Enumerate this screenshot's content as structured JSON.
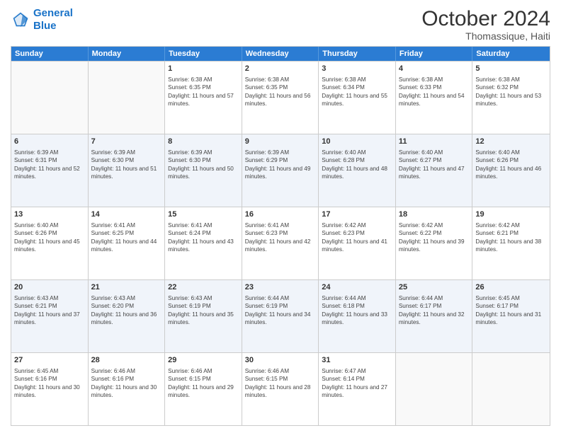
{
  "header": {
    "logo_line1": "General",
    "logo_line2": "Blue",
    "month": "October 2024",
    "location": "Thomassique, Haiti"
  },
  "days": [
    "Sunday",
    "Monday",
    "Tuesday",
    "Wednesday",
    "Thursday",
    "Friday",
    "Saturday"
  ],
  "weeks": [
    [
      {
        "day": "",
        "sunrise": "",
        "sunset": "",
        "daylight": ""
      },
      {
        "day": "",
        "sunrise": "",
        "sunset": "",
        "daylight": ""
      },
      {
        "day": "1",
        "sunrise": "Sunrise: 6:38 AM",
        "sunset": "Sunset: 6:35 PM",
        "daylight": "Daylight: 11 hours and 57 minutes."
      },
      {
        "day": "2",
        "sunrise": "Sunrise: 6:38 AM",
        "sunset": "Sunset: 6:35 PM",
        "daylight": "Daylight: 11 hours and 56 minutes."
      },
      {
        "day": "3",
        "sunrise": "Sunrise: 6:38 AM",
        "sunset": "Sunset: 6:34 PM",
        "daylight": "Daylight: 11 hours and 55 minutes."
      },
      {
        "day": "4",
        "sunrise": "Sunrise: 6:38 AM",
        "sunset": "Sunset: 6:33 PM",
        "daylight": "Daylight: 11 hours and 54 minutes."
      },
      {
        "day": "5",
        "sunrise": "Sunrise: 6:38 AM",
        "sunset": "Sunset: 6:32 PM",
        "daylight": "Daylight: 11 hours and 53 minutes."
      }
    ],
    [
      {
        "day": "6",
        "sunrise": "Sunrise: 6:39 AM",
        "sunset": "Sunset: 6:31 PM",
        "daylight": "Daylight: 11 hours and 52 minutes."
      },
      {
        "day": "7",
        "sunrise": "Sunrise: 6:39 AM",
        "sunset": "Sunset: 6:30 PM",
        "daylight": "Daylight: 11 hours and 51 minutes."
      },
      {
        "day": "8",
        "sunrise": "Sunrise: 6:39 AM",
        "sunset": "Sunset: 6:30 PM",
        "daylight": "Daylight: 11 hours and 50 minutes."
      },
      {
        "day": "9",
        "sunrise": "Sunrise: 6:39 AM",
        "sunset": "Sunset: 6:29 PM",
        "daylight": "Daylight: 11 hours and 49 minutes."
      },
      {
        "day": "10",
        "sunrise": "Sunrise: 6:40 AM",
        "sunset": "Sunset: 6:28 PM",
        "daylight": "Daylight: 11 hours and 48 minutes."
      },
      {
        "day": "11",
        "sunrise": "Sunrise: 6:40 AM",
        "sunset": "Sunset: 6:27 PM",
        "daylight": "Daylight: 11 hours and 47 minutes."
      },
      {
        "day": "12",
        "sunrise": "Sunrise: 6:40 AM",
        "sunset": "Sunset: 6:26 PM",
        "daylight": "Daylight: 11 hours and 46 minutes."
      }
    ],
    [
      {
        "day": "13",
        "sunrise": "Sunrise: 6:40 AM",
        "sunset": "Sunset: 6:26 PM",
        "daylight": "Daylight: 11 hours and 45 minutes."
      },
      {
        "day": "14",
        "sunrise": "Sunrise: 6:41 AM",
        "sunset": "Sunset: 6:25 PM",
        "daylight": "Daylight: 11 hours and 44 minutes."
      },
      {
        "day": "15",
        "sunrise": "Sunrise: 6:41 AM",
        "sunset": "Sunset: 6:24 PM",
        "daylight": "Daylight: 11 hours and 43 minutes."
      },
      {
        "day": "16",
        "sunrise": "Sunrise: 6:41 AM",
        "sunset": "Sunset: 6:23 PM",
        "daylight": "Daylight: 11 hours and 42 minutes."
      },
      {
        "day": "17",
        "sunrise": "Sunrise: 6:42 AM",
        "sunset": "Sunset: 6:23 PM",
        "daylight": "Daylight: 11 hours and 41 minutes."
      },
      {
        "day": "18",
        "sunrise": "Sunrise: 6:42 AM",
        "sunset": "Sunset: 6:22 PM",
        "daylight": "Daylight: 11 hours and 39 minutes."
      },
      {
        "day": "19",
        "sunrise": "Sunrise: 6:42 AM",
        "sunset": "Sunset: 6:21 PM",
        "daylight": "Daylight: 11 hours and 38 minutes."
      }
    ],
    [
      {
        "day": "20",
        "sunrise": "Sunrise: 6:43 AM",
        "sunset": "Sunset: 6:21 PM",
        "daylight": "Daylight: 11 hours and 37 minutes."
      },
      {
        "day": "21",
        "sunrise": "Sunrise: 6:43 AM",
        "sunset": "Sunset: 6:20 PM",
        "daylight": "Daylight: 11 hours and 36 minutes."
      },
      {
        "day": "22",
        "sunrise": "Sunrise: 6:43 AM",
        "sunset": "Sunset: 6:19 PM",
        "daylight": "Daylight: 11 hours and 35 minutes."
      },
      {
        "day": "23",
        "sunrise": "Sunrise: 6:44 AM",
        "sunset": "Sunset: 6:19 PM",
        "daylight": "Daylight: 11 hours and 34 minutes."
      },
      {
        "day": "24",
        "sunrise": "Sunrise: 6:44 AM",
        "sunset": "Sunset: 6:18 PM",
        "daylight": "Daylight: 11 hours and 33 minutes."
      },
      {
        "day": "25",
        "sunrise": "Sunrise: 6:44 AM",
        "sunset": "Sunset: 6:17 PM",
        "daylight": "Daylight: 11 hours and 32 minutes."
      },
      {
        "day": "26",
        "sunrise": "Sunrise: 6:45 AM",
        "sunset": "Sunset: 6:17 PM",
        "daylight": "Daylight: 11 hours and 31 minutes."
      }
    ],
    [
      {
        "day": "27",
        "sunrise": "Sunrise: 6:45 AM",
        "sunset": "Sunset: 6:16 PM",
        "daylight": "Daylight: 11 hours and 30 minutes."
      },
      {
        "day": "28",
        "sunrise": "Sunrise: 6:46 AM",
        "sunset": "Sunset: 6:16 PM",
        "daylight": "Daylight: 11 hours and 30 minutes."
      },
      {
        "day": "29",
        "sunrise": "Sunrise: 6:46 AM",
        "sunset": "Sunset: 6:15 PM",
        "daylight": "Daylight: 11 hours and 29 minutes."
      },
      {
        "day": "30",
        "sunrise": "Sunrise: 6:46 AM",
        "sunset": "Sunset: 6:15 PM",
        "daylight": "Daylight: 11 hours and 28 minutes."
      },
      {
        "day": "31",
        "sunrise": "Sunrise: 6:47 AM",
        "sunset": "Sunset: 6:14 PM",
        "daylight": "Daylight: 11 hours and 27 minutes."
      },
      {
        "day": "",
        "sunrise": "",
        "sunset": "",
        "daylight": ""
      },
      {
        "day": "",
        "sunrise": "",
        "sunset": "",
        "daylight": ""
      }
    ]
  ]
}
